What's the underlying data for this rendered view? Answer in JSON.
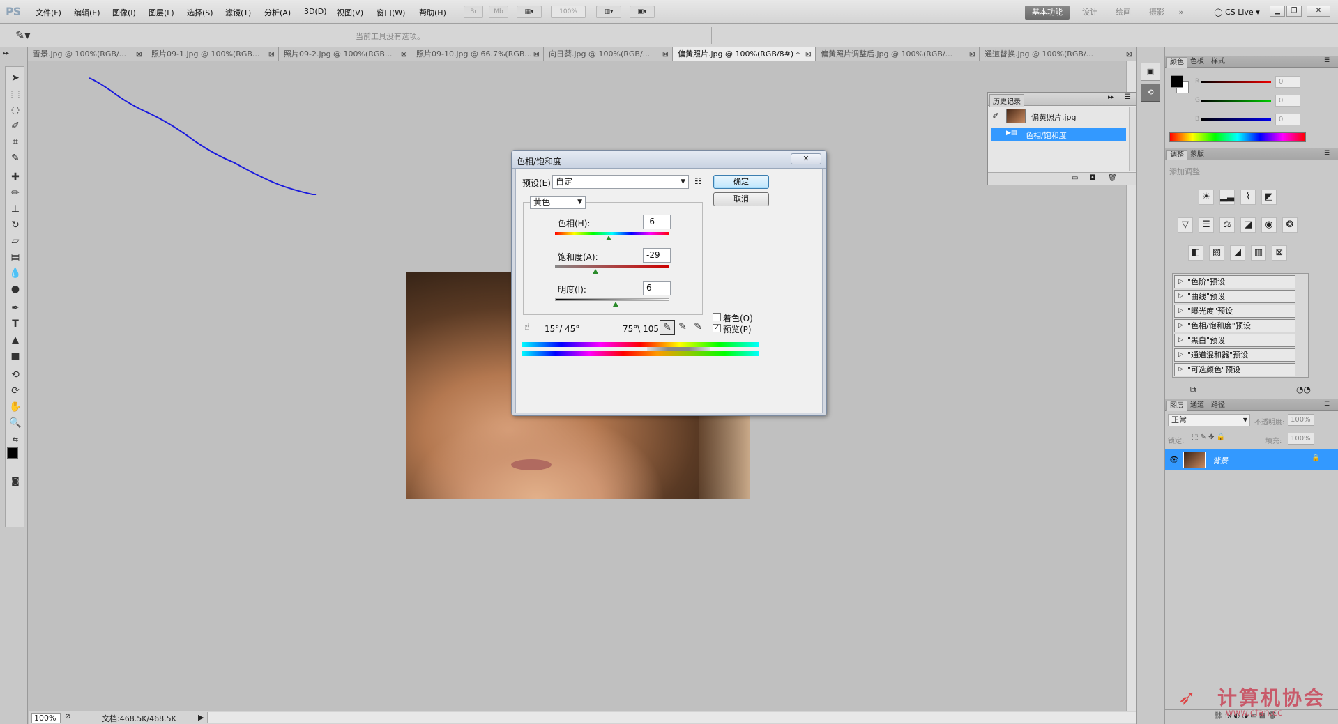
{
  "app": {
    "logo": "PS",
    "menus": [
      "文件(F)",
      "编辑(E)",
      "图像(I)",
      "图层(L)",
      "选择(S)",
      "滤镜(T)",
      "分析(A)",
      "3D(D)",
      "视图(V)",
      "窗口(W)",
      "帮助(H)"
    ],
    "zoom_field": "100%",
    "workspaces": [
      "基本功能",
      "设计",
      "绘画",
      "摄影"
    ],
    "cslive": "CS Live"
  },
  "options_bar": {
    "hint": "当前工具没有选项。"
  },
  "tabs": [
    "雪景.jpg @ 100%(RGB/...",
    "照片09-1.jpg @ 100%(RGB...",
    "照片09-2.jpg @ 100%(RGB...",
    "照片09-10.jpg @ 66.7%(RGB...",
    "向日葵.jpg @ 100%(RGB/...",
    "偏黄照片.jpg @ 100%(RGB/8#) *",
    "偏黄照片调整后.jpg @ 100%(RGB/...",
    "通道替换.jpg @ 100%(RGB/..."
  ],
  "status": {
    "zoom": "100%",
    "doc": "文档:468.5K/468.5K"
  },
  "history": {
    "title": "历史记录",
    "items": [
      "偏黄照片.jpg",
      "色相/饱和度"
    ]
  },
  "color_panel": {
    "tabs": [
      "颜色",
      "色板",
      "样式"
    ],
    "labels": [
      "R",
      "G",
      "B"
    ],
    "values": [
      "0",
      "0",
      "0"
    ]
  },
  "adjust_panel": {
    "tabs": [
      "调整",
      "蒙版"
    ],
    "add_label": "添加调整",
    "presets": [
      "\"色阶\"预设",
      "\"曲线\"预设",
      "\"曝光度\"预设",
      "\"色相/饱和度\"预设",
      "\"黑白\"预设",
      "\"通道混和器\"预设",
      "\"可选颜色\"预设"
    ]
  },
  "layers_panel": {
    "tabs": [
      "图层",
      "通道",
      "路径"
    ],
    "blend_mode": "正常",
    "opacity_label": "不透明度:",
    "opacity": "100%",
    "lock_label": "锁定:",
    "fill_label": "填充:",
    "fill": "100%",
    "layer_name": "背景"
  },
  "dialog": {
    "title": "色相/饱和度",
    "preset_label": "预设(E):",
    "preset_value": "自定",
    "ok": "确定",
    "cancel": "取消",
    "channel": "黄色",
    "hue_label": "色相(H):",
    "hue": "-6",
    "sat_label": "饱和度(A):",
    "sat": "-29",
    "light_label": "明度(I):",
    "light": "6",
    "range_left": "15°/ 45°",
    "range_right": "75°\\ 105°",
    "colorize_label": "着色(O)",
    "preview_label": "预览(P)",
    "preview_checked": true,
    "colorize_checked": false
  },
  "watermark": {
    "cn": "计算机协会",
    "url": "www.cfan.cc"
  },
  "colors": {
    "accent": "#3399ff",
    "pen_stroke": "#1a1add"
  }
}
